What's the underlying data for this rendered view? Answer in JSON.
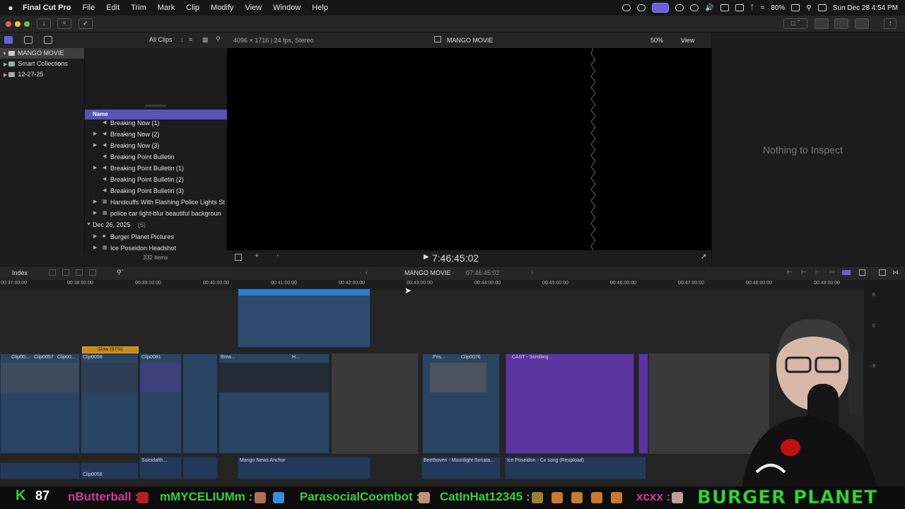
{
  "menubar": {
    "app_name": "Final Cut Pro",
    "menus": [
      "File",
      "Edit",
      "Trim",
      "Mark",
      "Clip",
      "Modify",
      "View",
      "Window",
      "Help"
    ],
    "battery": "80%",
    "datetime": "Sun Dec 28  4:54 PM"
  },
  "library": {
    "title": "MANGO MOVIE",
    "items": [
      "Smart Collections",
      "12-27-25"
    ]
  },
  "browser": {
    "filter": "All Clips",
    "column_name": "Name",
    "items": [
      {
        "label": "Breaking Now (1)",
        "expand": false
      },
      {
        "label": "Breaking Now (2)",
        "expand": true
      },
      {
        "label": "Breaking Now (3)",
        "expand": true
      },
      {
        "label": "Breaking Point Bulletin",
        "expand": false
      },
      {
        "label": "Breaking Point Bulletin (1)",
        "expand": true
      },
      {
        "label": "Breaking Point Bulletin (2)",
        "expand": false
      },
      {
        "label": "Breaking Point Bulletin (3)",
        "expand": false
      },
      {
        "label": "Handcuffs With Flashing Police Lights St",
        "expand": true
      },
      {
        "label": "police car light-blur beautiful backgroun",
        "expand": true
      }
    ],
    "group_label": "Dec 26, 2025",
    "group_count": "(6)",
    "group_items": [
      "Burger Planet Pictures",
      "Ice Poseidon Headshot"
    ],
    "item_count": "332 items"
  },
  "viewer": {
    "format": "4096 × 1716 | 24 fps, Stereo",
    "project": "MANGO MOVIE",
    "zoom": "50%",
    "view_menu": "View",
    "timecode": "7:46:45:02"
  },
  "inspector": {
    "empty_text": "Nothing to Inspect"
  },
  "timeline": {
    "index_label": "Index",
    "project": "MANGO MOVIE",
    "duration": "07:46:45:02",
    "ruler": [
      "00:37:00:00",
      "00:38:00:00",
      "00:39:00:00",
      "00:40:00:00",
      "00:41:00:00",
      "00:42:00:00",
      "00:43:00:00",
      "00:44:00:00",
      "00:45:00:00",
      "00:46:00:00",
      "00:47:00:00",
      "00:48:00:00",
      "00:49:00:00"
    ],
    "clips": [
      "Clip00...",
      "Clip0057",
      "Clip00...",
      "Clip0058",
      "Clip0081",
      "Brea...",
      "H...",
      "Pris...",
      "Clip0076",
      "CAST - Scrolling"
    ],
    "retime_label": "Slow (97%)",
    "audio_clips": [
      "Clip0058",
      "Suicidalth...",
      "Mango News Anchor",
      "Beethoven - Moonlight Sonata...",
      "Ice Poseidon - Cx song (Reupload)"
    ],
    "meter_labels": [
      "6",
      "0",
      "-6"
    ]
  },
  "ticker": {
    "score": "87",
    "names": [
      "nButterball :",
      "mMYCELIUMm :",
      "ParasocialCoombot :",
      "CatInHat12345 :",
      "xcxx :"
    ],
    "banner": "BURGER PLANET"
  }
}
